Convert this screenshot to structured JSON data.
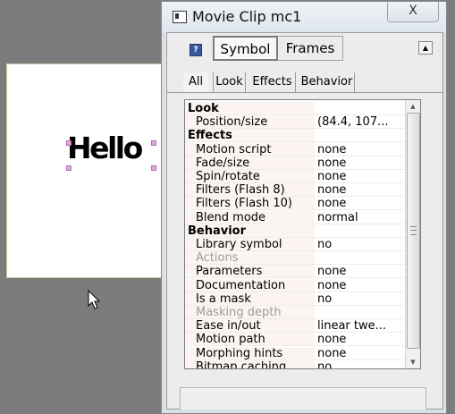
{
  "window": {
    "title": "Movie Clip mc1",
    "close_glyph": "X",
    "help_glyph": "?",
    "collapse_glyph": "▲"
  },
  "stage": {
    "text": "Hello",
    "background": "#ffffff"
  },
  "top_tabs": [
    {
      "label": "Symbol",
      "active": true
    },
    {
      "label": "Frames",
      "active": false
    }
  ],
  "sub_tabs": [
    {
      "label": "All",
      "active": true
    },
    {
      "label": "Look",
      "active": false
    },
    {
      "label": "Effects",
      "active": false
    },
    {
      "label": "Behavior",
      "active": false
    }
  ],
  "properties": [
    {
      "label": "Look",
      "category": true
    },
    {
      "label": "Position/size",
      "value": "(84.4, 107..."
    },
    {
      "label": "Effects",
      "category": true
    },
    {
      "label": "Motion script",
      "value": "none"
    },
    {
      "label": "Fade/size",
      "value": "none"
    },
    {
      "label": "Spin/rotate",
      "value": "none"
    },
    {
      "label": "Filters (Flash 8)",
      "value": "none"
    },
    {
      "label": "Filters (Flash 10)",
      "value": "none"
    },
    {
      "label": "Blend mode",
      "value": "normal"
    },
    {
      "label": "Behavior",
      "category": true
    },
    {
      "label": "Library symbol",
      "value": "no"
    },
    {
      "label": "Actions",
      "value": "",
      "disabled": true
    },
    {
      "label": "Parameters",
      "value": "none"
    },
    {
      "label": "Documentation",
      "value": "none"
    },
    {
      "label": "Is a mask",
      "value": "no"
    },
    {
      "label": "Masking depth",
      "value": "",
      "disabled": true
    },
    {
      "label": "Ease in/out",
      "value": "linear twe..."
    },
    {
      "label": "Motion path",
      "value": "none"
    },
    {
      "label": "Morphing hints",
      "value": "none"
    },
    {
      "label": "Bitmap caching",
      "value": "no"
    }
  ],
  "colors": {
    "desktop": "#7c7c7c",
    "selection_handle": "#e6a6e6",
    "label_column_bg": "#fcf4f1",
    "disabled_text": "#9c9c9c"
  },
  "icons": {
    "window": "movie-clip-window-icon",
    "help": "help-icon",
    "close": "close-icon",
    "cursor": "mouse-pointer-icon",
    "collapse": "collapse-up-icon"
  }
}
